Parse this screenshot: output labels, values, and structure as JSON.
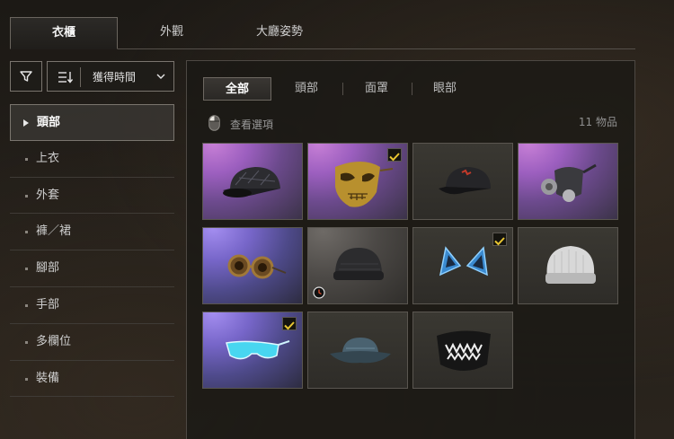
{
  "top_tabs": [
    {
      "label": "衣櫃",
      "active": true
    },
    {
      "label": "外觀",
      "active": false
    },
    {
      "label": "大廳姿勢",
      "active": false
    }
  ],
  "sort": {
    "label": "獲得時間"
  },
  "icons": {
    "filter": "filter-icon",
    "sort": "sort-lines-icon",
    "chevron": "chevron-down-icon",
    "mouse": "mouse-icon",
    "check": "checkmark-icon",
    "clock": "clock-icon"
  },
  "categories": [
    {
      "label": "頭部",
      "active": true
    },
    {
      "label": "上衣",
      "active": false
    },
    {
      "label": "外套",
      "active": false
    },
    {
      "label": "褲／裙",
      "active": false
    },
    {
      "label": "腳部",
      "active": false
    },
    {
      "label": "手部",
      "active": false
    },
    {
      "label": "多欄位",
      "active": false
    },
    {
      "label": "裝備",
      "active": false
    }
  ],
  "sub_tabs": [
    {
      "label": "全部",
      "active": true
    },
    {
      "label": "頭部",
      "active": false
    },
    {
      "label": "面罩",
      "active": false
    },
    {
      "label": "眼部",
      "active": false
    }
  ],
  "view_options": "查看選項",
  "item_count": "11 物品",
  "items": [
    {
      "name": "patterned-cap",
      "bg": "purple",
      "checked": false,
      "timed": false
    },
    {
      "name": "gold-skull-mask",
      "bg": "purple",
      "checked": true,
      "timed": false
    },
    {
      "name": "black-cap",
      "bg": "dark",
      "checked": false,
      "timed": false
    },
    {
      "name": "gas-mask",
      "bg": "purple",
      "checked": false,
      "timed": false
    },
    {
      "name": "steampunk-goggles",
      "bg": "blue",
      "checked": false,
      "timed": false
    },
    {
      "name": "gray-beanie",
      "bg": "gray",
      "checked": false,
      "timed": true
    },
    {
      "name": "cat-ears",
      "bg": "dark",
      "checked": true,
      "timed": false
    },
    {
      "name": "white-beanie",
      "bg": "dark",
      "checked": false,
      "timed": false
    },
    {
      "name": "cyan-sunglasses",
      "bg": "blue",
      "checked": true,
      "timed": false
    },
    {
      "name": "bucket-hat",
      "bg": "dark",
      "checked": false,
      "timed": false
    },
    {
      "name": "shark-teeth-mask",
      "bg": "dark",
      "checked": false,
      "timed": false
    }
  ],
  "colors": {
    "accent_check": "#e8c531",
    "panel_border": "#4d4843"
  }
}
